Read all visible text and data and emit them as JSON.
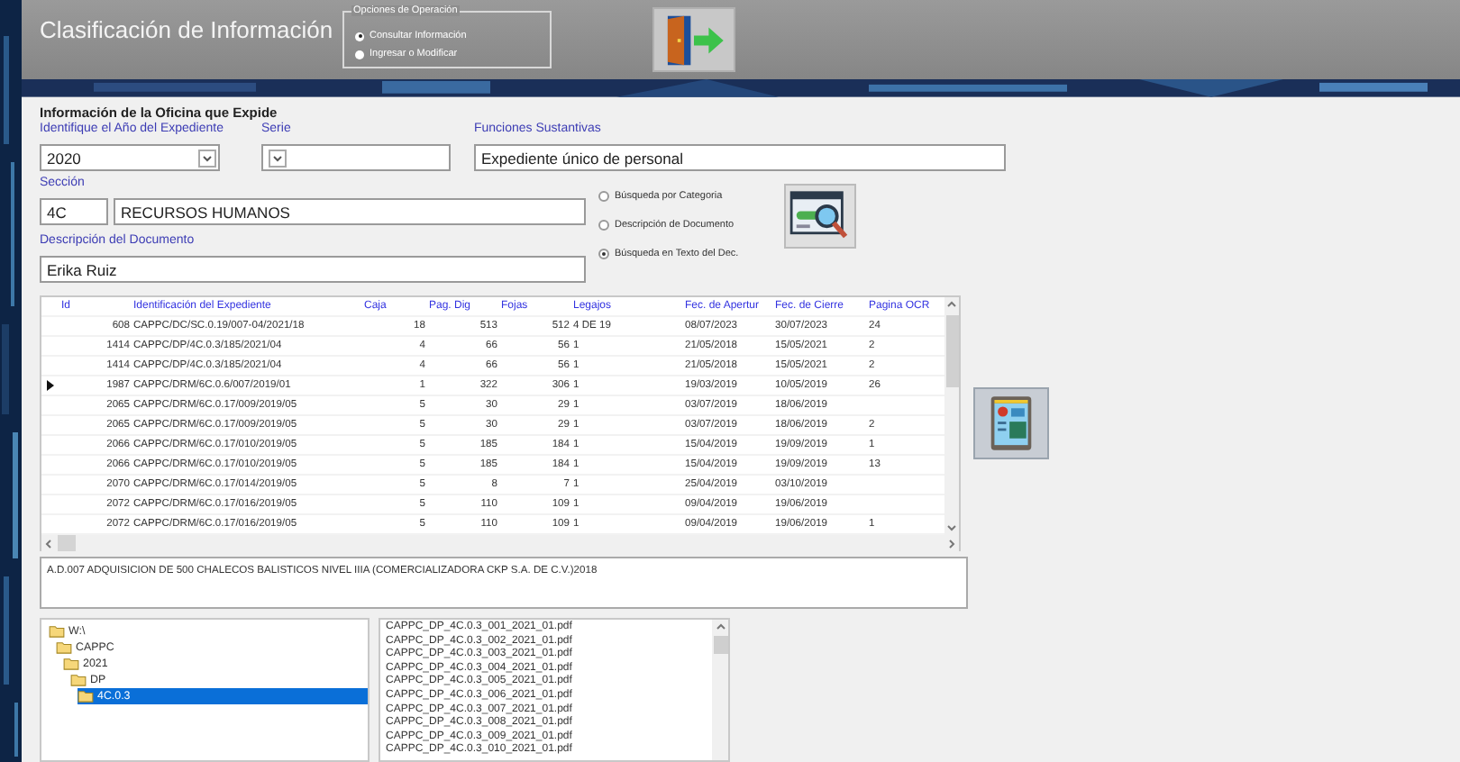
{
  "window": {
    "title": "Clasificación de Información"
  },
  "operation_options": {
    "legend": "Opciones de Operación",
    "options": [
      {
        "label": "Consultar Información",
        "selected": true
      },
      {
        "label": "Ingresar o Modificar",
        "selected": false
      }
    ]
  },
  "section_title": "Información de la Oficina que Expide",
  "year": {
    "label": "Identifique el Año del Expediente",
    "value": "2020"
  },
  "serie": {
    "label": "Serie"
  },
  "funciones": {
    "label": "Funciones Sustantivas",
    "value": "Expediente único de personal"
  },
  "seccion": {
    "label": "Sección",
    "code": "4C",
    "name": "RECURSOS HUMANOS"
  },
  "descripcion": {
    "label": "Descripción del Documento",
    "value": "Erika Ruiz"
  },
  "search_modes": [
    {
      "label": "Búsqueda por Categoria",
      "selected": false
    },
    {
      "label": "Descripción de Documento",
      "selected": false
    },
    {
      "label": "Búsqueda en Texto del Dec.",
      "selected": true
    }
  ],
  "table": {
    "columns": [
      "Id",
      "Identificación del Expediente",
      "Caja",
      "Pag. Dig",
      "Fojas",
      "Legajos",
      "Fec. de Apertur",
      "Fec. de Cierre",
      "Pagina OCR"
    ],
    "rows": [
      {
        "selected": false,
        "cells": [
          "608",
          "CAPPC/DC/SC.0.19/007-04/2021/18",
          "18",
          "513",
          "512",
          "4 DE 19",
          "08/07/2023",
          "30/07/2023",
          "24"
        ]
      },
      {
        "selected": false,
        "cells": [
          "1414",
          "CAPPC/DP/4C.0.3/185/2021/04",
          "4",
          "66",
          "56",
          "1",
          "21/05/2018",
          "15/05/2021",
          "2"
        ]
      },
      {
        "selected": false,
        "cells": [
          "1414",
          "CAPPC/DP/4C.0.3/185/2021/04",
          "4",
          "66",
          "56",
          "1",
          "21/05/2018",
          "15/05/2021",
          "2"
        ]
      },
      {
        "selected": true,
        "cells": [
          "1987",
          "CAPPC/DRM/6C.0.6/007/2019/01",
          "1",
          "322",
          "306",
          "1",
          "19/03/2019",
          "10/05/2019",
          "26"
        ]
      },
      {
        "selected": false,
        "cells": [
          "2065",
          "CAPPC/DRM/6C.0.17/009/2019/05",
          "5",
          "30",
          "29",
          "1",
          "03/07/2019",
          "18/06/2019"
        ]
      },
      {
        "selected": false,
        "cells": [
          "2065",
          "CAPPC/DRM/6C.0.17/009/2019/05",
          "5",
          "30",
          "29",
          "1",
          "03/07/2019",
          "18/06/2019",
          "2"
        ]
      },
      {
        "selected": false,
        "cells": [
          "2066",
          "CAPPC/DRM/6C.0.17/010/2019/05",
          "5",
          "185",
          "184",
          "1",
          "15/04/2019",
          "19/09/2019",
          "1"
        ]
      },
      {
        "selected": false,
        "cells": [
          "2066",
          "CAPPC/DRM/6C.0.17/010/2019/05",
          "5",
          "185",
          "184",
          "1",
          "15/04/2019",
          "19/09/2019",
          "13"
        ]
      },
      {
        "selected": false,
        "cells": [
          "2070",
          "CAPPC/DRM/6C.0.17/014/2019/05",
          "5",
          "8",
          "7",
          "1",
          "25/04/2019",
          "03/10/2019"
        ]
      },
      {
        "selected": false,
        "cells": [
          "2072",
          "CAPPC/DRM/6C.0.17/016/2019/05",
          "5",
          "110",
          "109",
          "1",
          "09/04/2019",
          "19/06/2019"
        ]
      },
      {
        "selected": false,
        "cells": [
          "2072",
          "CAPPC/DRM/6C.0.17/016/2019/05",
          "5",
          "110",
          "109",
          "1",
          "09/04/2019",
          "19/06/2019",
          "1"
        ]
      }
    ]
  },
  "detail_text": "A.D.007 ADQUISICION DE 500 CHALECOS BALISTICOS NIVEL IIIA (COMERCIALIZADORA CKP S.A. DE C.V.)2018",
  "folders": [
    {
      "label": "W:\\",
      "selected": false,
      "children": [
        {
          "label": "CAPPC",
          "selected": false,
          "children": [
            {
              "label": "2021",
              "selected": false,
              "children": [
                {
                  "label": "DP",
                  "selected": false,
                  "children": [
                    {
                      "label": "4C.0.3",
                      "selected": true
                    }
                  ]
                }
              ]
            }
          ]
        }
      ]
    }
  ],
  "files": [
    "CAPPC_DP_4C.0.3_001_2021_01.pdf",
    "CAPPC_DP_4C.0.3_002_2021_01.pdf",
    "CAPPC_DP_4C.0.3_003_2021_01.pdf",
    "CAPPC_DP_4C.0.3_004_2021_01.pdf",
    "CAPPC_DP_4C.0.3_005_2021_01.pdf",
    "CAPPC_DP_4C.0.3_006_2021_01.pdf",
    "CAPPC_DP_4C.0.3_007_2021_01.pdf",
    "CAPPC_DP_4C.0.3_008_2021_01.pdf",
    "CAPPC_DP_4C.0.3_009_2021_01.pdf",
    "CAPPC_DP_4C.0.3_010_2021_01.pdf"
  ]
}
